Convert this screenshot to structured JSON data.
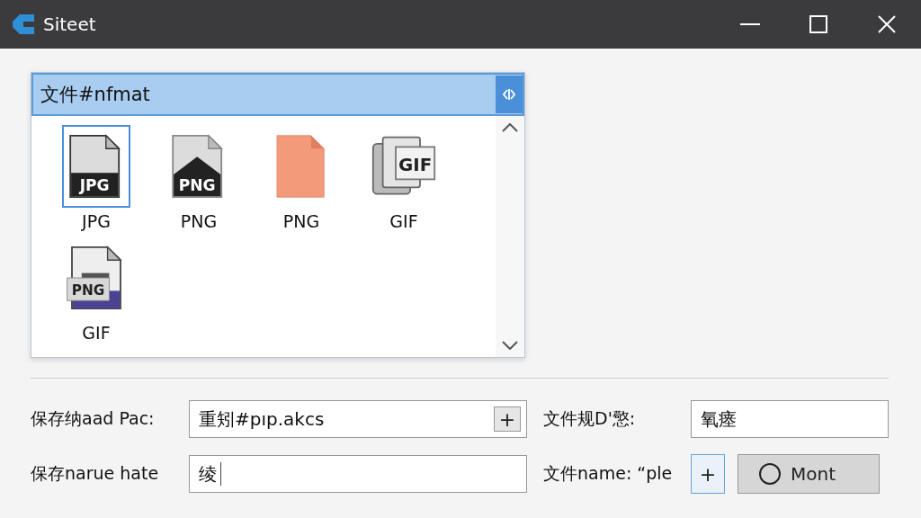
{
  "window": {
    "title": "Siteet"
  },
  "format_combo": {
    "value": "文件#nfmat",
    "expanded": true
  },
  "files": [
    {
      "kind": "jpg",
      "badges": [
        "JPG"
      ],
      "label": "JPG",
      "selected": true
    },
    {
      "kind": "png",
      "badges": [
        "PNG"
      ],
      "label": "PNG",
      "selected": false
    },
    {
      "kind": "blank",
      "label": "PNG",
      "selected": false
    },
    {
      "kind": "stack",
      "badges": [
        "GIF"
      ],
      "label": "GIF",
      "selected": false
    },
    {
      "kind": "combo",
      "badges": [
        "PNG"
      ],
      "label": "GIF",
      "selected": false
    }
  ],
  "form": {
    "save_path": {
      "label": "保存纳aad Pac:",
      "value": "重矧#pıp.akcs",
      "button": "+"
    },
    "file_rule": {
      "label": "文件规D'憼:",
      "value": "氧瘗"
    },
    "save_name": {
      "label": "保存narue hate",
      "value": "绫"
    },
    "file_name": {
      "label": "文件name: “ple",
      "button": "+"
    },
    "mount_button": {
      "label": "Mont"
    }
  }
}
